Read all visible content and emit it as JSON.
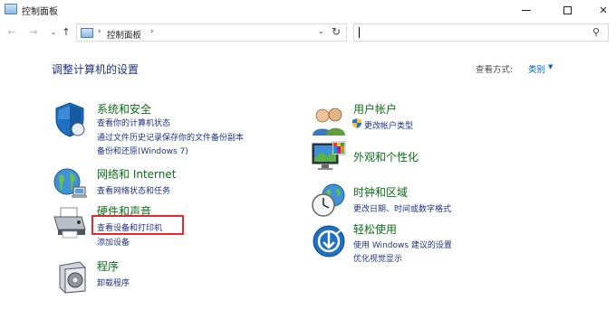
{
  "window": {
    "title": "控制面板",
    "minimize": "—",
    "close": "✕"
  },
  "nav": {
    "back": "←",
    "forward": "→",
    "recent": "⌄",
    "up": "↑",
    "breadcrumb_sep1": "›",
    "breadcrumb": "控制面板",
    "breadcrumb_sep2": "›",
    "dropdown": "⌄",
    "refresh": "↻",
    "search_value": "",
    "search_icon": "⚲"
  },
  "main": {
    "heading": "调整计算机的设置",
    "view_by_label": "查看方式:",
    "view_by_value": "类别",
    "view_by_arrow": "▼"
  },
  "categories": {
    "system_security": {
      "title": "系统和安全",
      "links": [
        "查看你的计算机状态",
        "通过文件历史记录保存你的文件备份副本",
        "备份和还原(Windows 7)"
      ],
      "icon": "shield-icon"
    },
    "network": {
      "title": "网络和 Internet",
      "links": [
        "查看网络状态和任务"
      ],
      "icon": "network-globe-icon"
    },
    "hardware": {
      "title": "硬件和声音",
      "links": [
        "查看设备和打印机",
        "添加设备"
      ],
      "icon": "printer-icon"
    },
    "programs": {
      "title": "程序",
      "links": [
        "卸载程序"
      ],
      "icon": "programs-icon"
    },
    "user_accounts": {
      "title": "用户帐户",
      "links": [
        "更改帐户类型"
      ],
      "icon": "users-icon"
    },
    "appearance": {
      "title": "外观和个性化",
      "links": [],
      "icon": "monitor-palette-icon"
    },
    "clock_region": {
      "title": "时钟和区域",
      "links": [
        "更改日期、时间或数字格式"
      ],
      "icon": "clock-globe-icon"
    },
    "ease_access": {
      "title": "轻松使用",
      "links": [
        "使用 Windows 建议的设置",
        "优化视觉显示"
      ],
      "icon": "accessibility-icon"
    }
  },
  "colors": {
    "category_title": "#0b6e19",
    "link": "#1e3287",
    "highlight": "#e6262d",
    "accent": "#0066cc"
  }
}
